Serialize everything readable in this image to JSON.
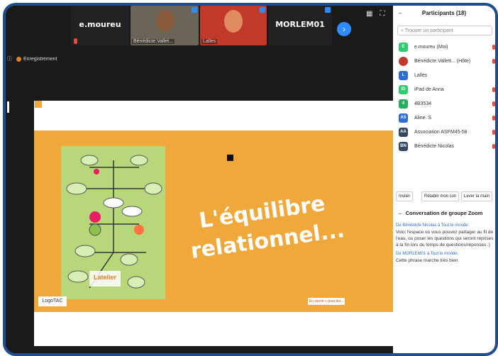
{
  "thumbnails": [
    {
      "name": "e.moureu",
      "caption": ""
    },
    {
      "name": "",
      "caption": "Bénédicte.Vallet..."
    },
    {
      "name": "",
      "caption": "Lalles"
    },
    {
      "name": "MORLEM01",
      "caption": ""
    }
  ],
  "recording_label": "Enregistrement",
  "slide": {
    "title_line1": "L'équilibre",
    "title_line2": "relationnel...",
    "logo_text": "Latelier",
    "bottom_logo": "LogoTAC",
    "bottom_link": "En savoir + pour les..."
  },
  "participants": {
    "title": "Participants (18)",
    "search_placeholder": "Trouver un participant",
    "list": [
      {
        "initials": "E",
        "name": "e.moureu (Moi)",
        "color": "#2ecc71"
      },
      {
        "initials": "",
        "name": "Bénédicte.Vallett... (Hôte)",
        "color": "#c0392b"
      },
      {
        "initials": "L",
        "name": "Lalles",
        "color": "#2d6fcf"
      },
      {
        "initials": "ID",
        "name": "iPad de Anna",
        "color": "#2ecc71"
      },
      {
        "initials": "4",
        "name": "4B3534",
        "color": "#27ae60"
      },
      {
        "initials": "AS",
        "name": "Aline. S",
        "color": "#2d6fcf"
      },
      {
        "initials": "AA",
        "name": "Association ASFM45-58",
        "color": "#34495e"
      },
      {
        "initials": "BN",
        "name": "Bénédicte Nicolas",
        "color": "#34495e"
      }
    ],
    "buttons": [
      "Inviter",
      "Rétablir mon son",
      "Lever la main"
    ]
  },
  "chat": {
    "title": "Conversation de groupe Zoom",
    "messages": [
      {
        "from": "De Bénédicte Nicolas à Tout le monde:",
        "text": "Voici l'espace où vous pouvez partager au fil de l'eau, ou poser les questions qui seront reprises à la fin lors du temps de questions/réponses :)"
      },
      {
        "from": "De MORLEM01 à Tout le monde:",
        "text": "Cette phrase marche très bien"
      }
    ]
  }
}
